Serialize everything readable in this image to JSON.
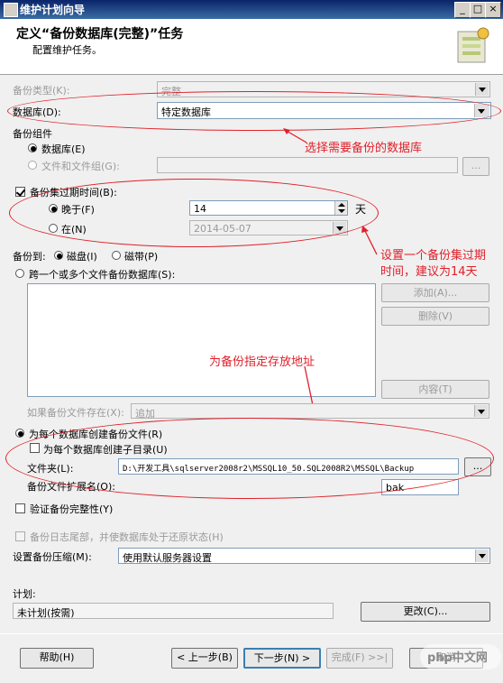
{
  "window": {
    "title": "维护计划向导",
    "minimize": "_",
    "maximize": "□",
    "close": "×"
  },
  "header": {
    "title": "定义“备份数据库(完整)”任务",
    "subtitle": "配置维护任务。"
  },
  "backup_type": {
    "label": "备份类型(K):",
    "value": "完整"
  },
  "database": {
    "label": "数据库(D):",
    "value": "特定数据库"
  },
  "components": {
    "label": "备份组件",
    "database_label": "数据库(E)",
    "files_label": "文件和文件组(G):",
    "browse_label": "..."
  },
  "expire": {
    "label": "备份集过期时间(B):",
    "after_label": "晚于(F)",
    "after_value": "14",
    "days_label": "天",
    "on_label": "在(N)",
    "on_value": "2014-05-07"
  },
  "backup_to": {
    "label": "备份到:",
    "disk_label": "磁盘(I)",
    "tape_label": "磁带(P)"
  },
  "span": {
    "label": "跨一个或多个文件备份数据库(S):",
    "add_label": "添加(A)...",
    "remove_label": "删除(V)",
    "contents_label": "内容(T)"
  },
  "if_exists": {
    "label": "如果备份文件存在(X):",
    "value": "追加"
  },
  "per_db": {
    "label": "为每个数据库创建备份文件(R)",
    "subdir_label": "为每个数据库创建子目录(U)",
    "folder_label": "文件夹(L):",
    "folder_value": "D:\\开发工具\\sqlserver2008r2\\MSSQL10_50.SQL2008R2\\MSSQL\\Backup",
    "browse_label": "...",
    "ext_label": "备份文件扩展名(O):",
    "ext_value": "bak"
  },
  "verify": {
    "label": "验证备份完整性(Y)"
  },
  "tail_log": {
    "label": "备份日志尾部，并使数据库处于还原状态(H)"
  },
  "compression": {
    "label": "设置备份压缩(M):",
    "value": "使用默认服务器设置"
  },
  "schedule": {
    "label": "计划:",
    "value": "未计划(按需)",
    "change_label": "更改(C)..."
  },
  "footer": {
    "help": "帮助(H)",
    "back": "< 上一步(B)",
    "next": "下一步(N) >",
    "finish": "完成(F) >>|",
    "cancel": "取消"
  },
  "annotations": {
    "select_db": "选择需要备份的数据库",
    "expire_1": "设置一个备份集过期",
    "expire_2": "时间，建议为14天",
    "path": "为备份指定存放地址"
  },
  "watermark": "php中文网",
  "colors": {
    "annotation": "#e0202a",
    "title_bar": "#0a246a"
  }
}
